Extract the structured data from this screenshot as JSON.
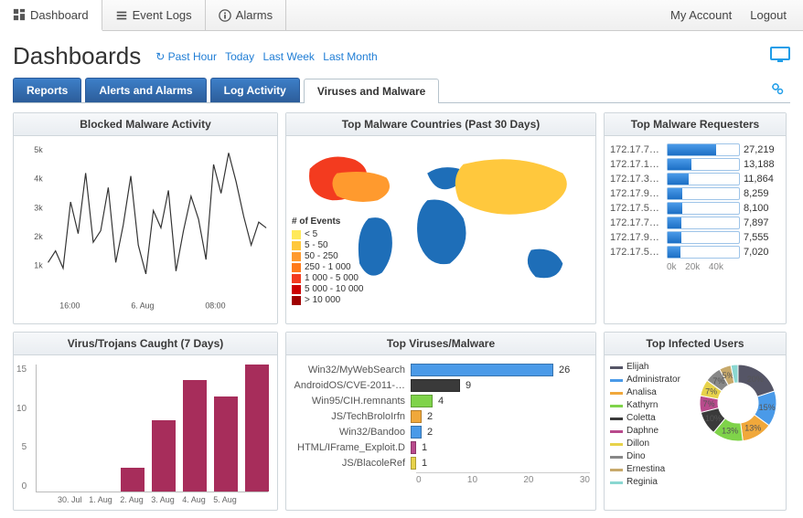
{
  "topnav": {
    "items": [
      {
        "icon": "dashboard",
        "label": "Dashboard",
        "active": true
      },
      {
        "icon": "list",
        "label": "Event Logs",
        "active": false
      },
      {
        "icon": "info",
        "label": "Alarms",
        "active": false
      }
    ],
    "right": {
      "account": "My Account",
      "logout": "Logout"
    }
  },
  "page_title": "Dashboards",
  "time_links": [
    "Past Hour",
    "Today",
    "Last Week",
    "Last Month"
  ],
  "tabs": [
    {
      "label": "Reports",
      "active": false
    },
    {
      "label": "Alerts and Alarms",
      "active": false
    },
    {
      "label": "Log Activity",
      "active": false
    },
    {
      "label": "Viruses and Malware",
      "active": true
    }
  ],
  "panels": {
    "blocked": {
      "title": "Blocked Malware Activity"
    },
    "countries": {
      "title": "Top Malware Countries (Past 30 Days)",
      "legend_title": "# of Events",
      "legend": [
        {
          "c": "#ffe95a",
          "t": "< 5"
        },
        {
          "c": "#ffc83d",
          "t": "5 - 50"
        },
        {
          "c": "#ff9a2e",
          "t": "50 - 250"
        },
        {
          "c": "#ff7a1a",
          "t": "250 - 1 000"
        },
        {
          "c": "#f33b1f",
          "t": "1 000 - 5 000"
        },
        {
          "c": "#cc0000",
          "t": "5 000 - 10 000"
        },
        {
          "c": "#a00000",
          "t": "> 10 000"
        }
      ]
    },
    "requesters": {
      "title": "Top Malware Requesters",
      "axis": [
        "0k",
        "20k",
        "40k"
      ]
    },
    "vtc": {
      "title": "Virus/Trojans Caught (7 Days)"
    },
    "topvm": {
      "title": "Top Viruses/Malware",
      "axis": [
        "0",
        "10",
        "20",
        "30"
      ]
    },
    "infected": {
      "title": "Top Infected Users"
    }
  },
  "chart_data": {
    "blocked_activity": {
      "type": "line",
      "ylabel": "",
      "ylim": [
        0,
        5000
      ],
      "y_ticks": [
        "1k",
        "2k",
        "3k",
        "4k",
        "5k"
      ],
      "x_ticks": [
        "16:00",
        "6. Aug",
        "08:00"
      ],
      "values": [
        1100,
        1500,
        900,
        3200,
        2100,
        4200,
        1800,
        2200,
        3700,
        1100,
        2400,
        4100,
        1700,
        700,
        2900,
        2300,
        3600,
        800,
        2200,
        3400,
        2600,
        1200,
        4500,
        3500,
        4900,
        3900,
        2700,
        1700,
        2500,
        2300
      ]
    },
    "top_malware_countries": {
      "type": "choropleth",
      "metric": "# of Events",
      "bins": [
        "< 5",
        "5 - 50",
        "50 - 250",
        "250 - 1 000",
        "1 000 - 5 000",
        "5 000 - 10 000",
        "> 10 000"
      ]
    },
    "top_malware_requesters": {
      "type": "bar",
      "orientation": "h",
      "xlim": [
        0,
        40000
      ],
      "categories": [
        "172.17.7…",
        "172.17.1…",
        "172.17.3…",
        "172.17.9…",
        "172.17.5…",
        "172.17.7…",
        "172.17.9…",
        "172.17.5…"
      ],
      "values": [
        27219,
        13188,
        11864,
        8259,
        8100,
        7897,
        7555,
        7020
      ]
    },
    "virus_trojans_caught": {
      "type": "bar",
      "ylim": [
        0,
        16
      ],
      "y_ticks": [
        0,
        5,
        10,
        15
      ],
      "categories": [
        "30. Jul",
        "1. Aug",
        "2. Aug",
        "3. Aug",
        "4. Aug",
        "5. Aug"
      ],
      "values": [
        0,
        0,
        3,
        9,
        14,
        12,
        16
      ]
    },
    "top_viruses_malware": {
      "type": "bar",
      "orientation": "h",
      "xlim": [
        0,
        30
      ],
      "series": [
        {
          "name": "Win32/MyWebSearch",
          "value": 26,
          "color": "#4a9ae8"
        },
        {
          "name": "AndroidOS/CVE-2011-…",
          "value": 9,
          "color": "#3a3a3a"
        },
        {
          "name": "Win95/CIH.remnants",
          "value": 4,
          "color": "#7fd34a"
        },
        {
          "name": "JS/TechBroloIrfn",
          "value": 2,
          "color": "#f0a83b"
        },
        {
          "name": "Win32/Bandoo",
          "value": 2,
          "color": "#4a9ae8"
        },
        {
          "name": "HTML/IFrame_Exploit.D",
          "value": 1,
          "color": "#b84a8c"
        },
        {
          "name": "JS/BlacoleRef",
          "value": 1,
          "color": "#e7d24a"
        }
      ]
    },
    "top_infected_users": {
      "type": "pie",
      "series": [
        {
          "name": "Elijah",
          "value": 20,
          "color": "#556"
        },
        {
          "name": "Administrator",
          "value": 15,
          "color": "#4a9ae8"
        },
        {
          "name": "Analisa",
          "value": 13,
          "color": "#f0a83b"
        },
        {
          "name": "Kathyrn",
          "value": 13,
          "color": "#7fd34a"
        },
        {
          "name": "Coletta",
          "value": 10,
          "color": "#3a3a3a"
        },
        {
          "name": "Daphne",
          "value": 7,
          "color": "#b84a8c"
        },
        {
          "name": "Dillon",
          "value": 7,
          "color": "#e7d24a"
        },
        {
          "name": "Dino",
          "value": 7,
          "color": "#888"
        },
        {
          "name": "Ernestina",
          "value": 5,
          "color": "#c7a96b"
        },
        {
          "name": "Reginia",
          "value": 3,
          "color": "#8ad7d1"
        }
      ]
    }
  }
}
